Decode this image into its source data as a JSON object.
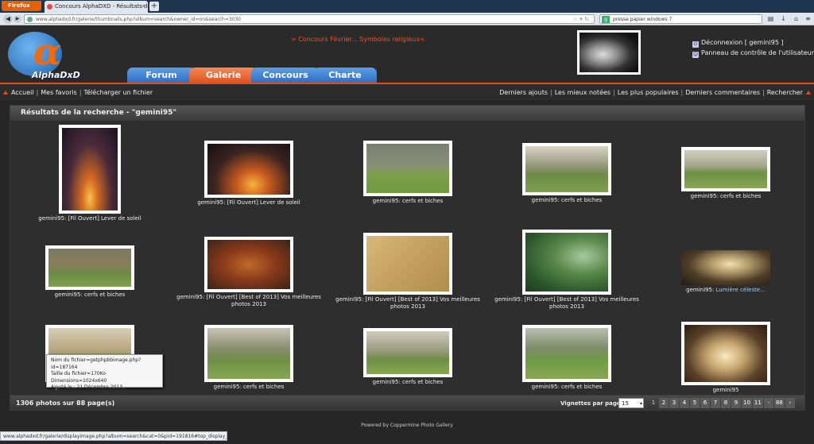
{
  "browser": {
    "menu_label": "Firefox",
    "tab_title": "Concours AlphaDXD - Résultats de la rec...",
    "url": "www.alphadxd.fr/galerie/thumbnails.php?album=search&owner_id=on&search=3030",
    "search_value": "presse papier windows 7",
    "status_url": "www.alphadxd.fr/galerie/displayimage.php?album=search&cat=0&pid=191816#top_display_media"
  },
  "site": {
    "logo_symbol": "α",
    "logo_text": "AlphaDxD",
    "announcement": "> Concours Février... Symboles religieux<",
    "tabs": [
      {
        "label": "Forum",
        "active": false
      },
      {
        "label": "Galerie",
        "active": true
      },
      {
        "label": "Concours",
        "active": false
      },
      {
        "label": "Charte",
        "active": false
      }
    ],
    "user": {
      "logout": "Déconnexion [ gemini95 ]",
      "control_panel": "Panneau de contrôle de l'utilisateur"
    }
  },
  "menu": {
    "left": [
      "Accueil",
      "Mes favoris",
      "Télécharger un fichier"
    ],
    "right": [
      "Derniers ajouts",
      "Les mieux notées",
      "Les plus populaires",
      "Derniers commentaires",
      "Rechercher"
    ]
  },
  "gallery": {
    "title": "Résultats de la recherche - \"gemini95\"",
    "items": [
      {
        "caption": "gemini95: [Fil Ouvert] Lever de soleil",
        "alt": "",
        "scene": "sunset-portrait"
      },
      {
        "caption": "gemini95: [Fil Ouvert] Lever de soleil",
        "alt": "",
        "scene": "sunset"
      },
      {
        "caption": "gemini95: cerfs et biches",
        "alt": "",
        "scene": "deer"
      },
      {
        "caption": "gemini95: cerfs et biches",
        "alt": "",
        "scene": "meadow"
      },
      {
        "caption": "gemini95: cerfs et biches",
        "alt": "",
        "scene": "meadow2"
      },
      {
        "caption": "gemini95: cerfs et biches",
        "alt": "",
        "scene": "herd"
      },
      {
        "caption": "gemini95: [Fil Ouvert] [Best of 2013] Vos meilleures photos 2013",
        "alt": "",
        "scene": "autumn"
      },
      {
        "caption": "gemini95: [Fil Ouvert] [Best of 2013] Vos meilleures photos 2013",
        "alt": "",
        "scene": "wheat"
      },
      {
        "caption": "gemini95: [Fil Ouvert] [Best of 2013] Vos meilleures photos 2013",
        "alt": "",
        "scene": "roe"
      },
      {
        "caption": "gemini95:",
        "alt": "Lumière céleste...",
        "scene": "rays"
      },
      {
        "caption": "gemini95: cerfs et biches",
        "alt": "",
        "scene": "mist"
      },
      {
        "caption": "gemini95: cerfs et biches",
        "alt": "",
        "scene": "field"
      },
      {
        "caption": "gemini95: cerfs et biches",
        "alt": "",
        "scene": "field2"
      },
      {
        "caption": "gemini95: cerfs et biches",
        "alt": "",
        "scene": "deergroup"
      },
      {
        "caption": "gemini95",
        "alt": "",
        "scene": "candles"
      }
    ],
    "tooltip": [
      "Nom du fichier=getphpbbimage.php?id=187164",
      "Taille du fichier=170Ko",
      "Dimensions=1024x640",
      "Ajouté le : 21 Décembre 2013"
    ]
  },
  "footer": {
    "count": "1306 photos sur 88 page(s)",
    "per_page_label": "Vignettes par page",
    "per_page_value": "15",
    "pages": [
      "1",
      "2",
      "3",
      "4",
      "5",
      "6",
      "7",
      "8",
      "9",
      "10",
      "11",
      "-",
      "88",
      "›"
    ],
    "current_page": "1",
    "powered": "Powered by Coppermine Photo Gallery"
  },
  "colors": {
    "accent_orange": "#e0501e",
    "tab_blue": "#2d6bc1",
    "background": "#262626"
  }
}
